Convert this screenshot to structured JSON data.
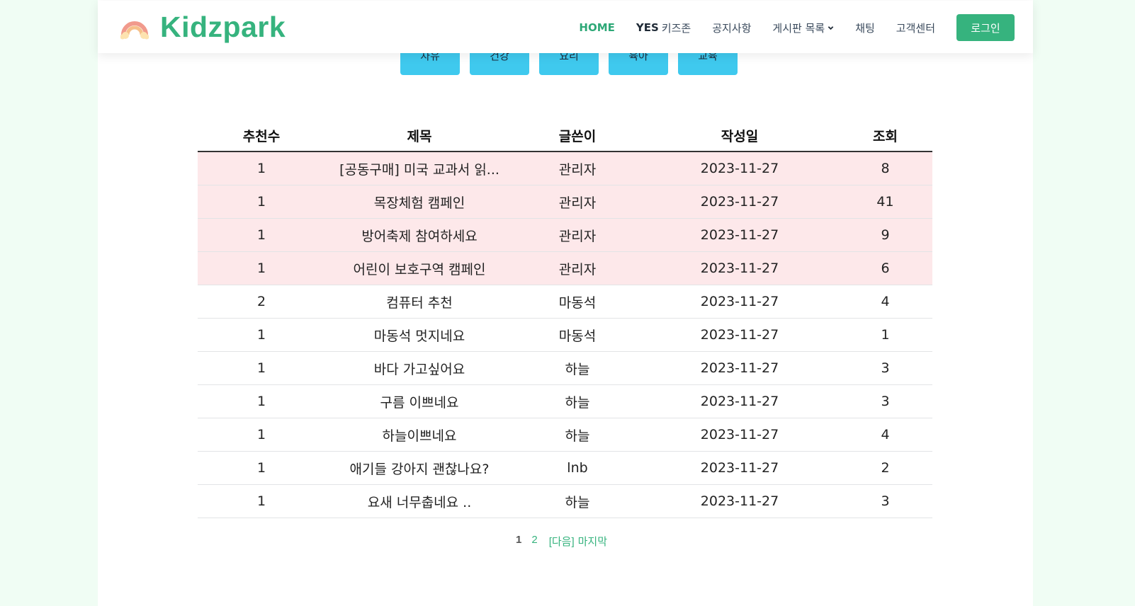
{
  "header": {
    "logo_text": "Kidzpark",
    "nav": [
      {
        "label": "HOME"
      },
      {
        "label_prefix": "YES",
        "label": "키즈존"
      },
      {
        "label": "공지사항"
      },
      {
        "label": "게시판 목록"
      },
      {
        "label": "채팅"
      },
      {
        "label": "고객센터"
      }
    ],
    "login_label": "로그인"
  },
  "categories": [
    "자유",
    "건강",
    "요리",
    "육아",
    "교육"
  ],
  "table": {
    "headers": {
      "recommend": "추천수",
      "title": "제목",
      "writer": "글쓴이",
      "date": "작성일",
      "views": "조회"
    },
    "rows": [
      {
        "recommend": "1",
        "title": "[공동구매] 미국 교과서 읽...",
        "writer": "관리자",
        "date": "2023-11-27",
        "views": "8",
        "notice": true
      },
      {
        "recommend": "1",
        "title": "목장체험 캠페인",
        "writer": "관리자",
        "date": "2023-11-27",
        "views": "41",
        "notice": true
      },
      {
        "recommend": "1",
        "title": "방어축제 참여하세요",
        "writer": "관리자",
        "date": "2023-11-27",
        "views": "9",
        "notice": true
      },
      {
        "recommend": "1",
        "title": "어린이 보호구역 캠페인",
        "writer": "관리자",
        "date": "2023-11-27",
        "views": "6",
        "notice": true
      },
      {
        "recommend": "2",
        "title": "컴퓨터 추천",
        "writer": "마동석",
        "date": "2023-11-27",
        "views": "4",
        "notice": false
      },
      {
        "recommend": "1",
        "title": "마동석 멋지네요",
        "writer": "마동석",
        "date": "2023-11-27",
        "views": "1",
        "notice": false
      },
      {
        "recommend": "1",
        "title": "바다 가고싶어요",
        "writer": "하늘",
        "date": "2023-11-27",
        "views": "3",
        "notice": false
      },
      {
        "recommend": "1",
        "title": "구름 이쁘네요",
        "writer": "하늘",
        "date": "2023-11-27",
        "views": "3",
        "notice": false
      },
      {
        "recommend": "1",
        "title": "하늘이쁘네요",
        "writer": "하늘",
        "date": "2023-11-27",
        "views": "4",
        "notice": false
      },
      {
        "recommend": "1",
        "title": "애기들 강아지 괜찮나요?",
        "writer": "lnb",
        "date": "2023-11-27",
        "views": "2",
        "notice": false
      },
      {
        "recommend": "1",
        "title": "요새 너무춥네요 ..",
        "writer": "하늘",
        "date": "2023-11-27",
        "views": "3",
        "notice": false
      }
    ]
  },
  "pagination": {
    "current": "1",
    "page2": "2",
    "next": "[다음]",
    "last": "마지막"
  },
  "colors": {
    "brand": "#36b37e",
    "category_button": "#3fc9ee",
    "notice_row": "#fde8ea",
    "background": "#f0fdf4"
  }
}
